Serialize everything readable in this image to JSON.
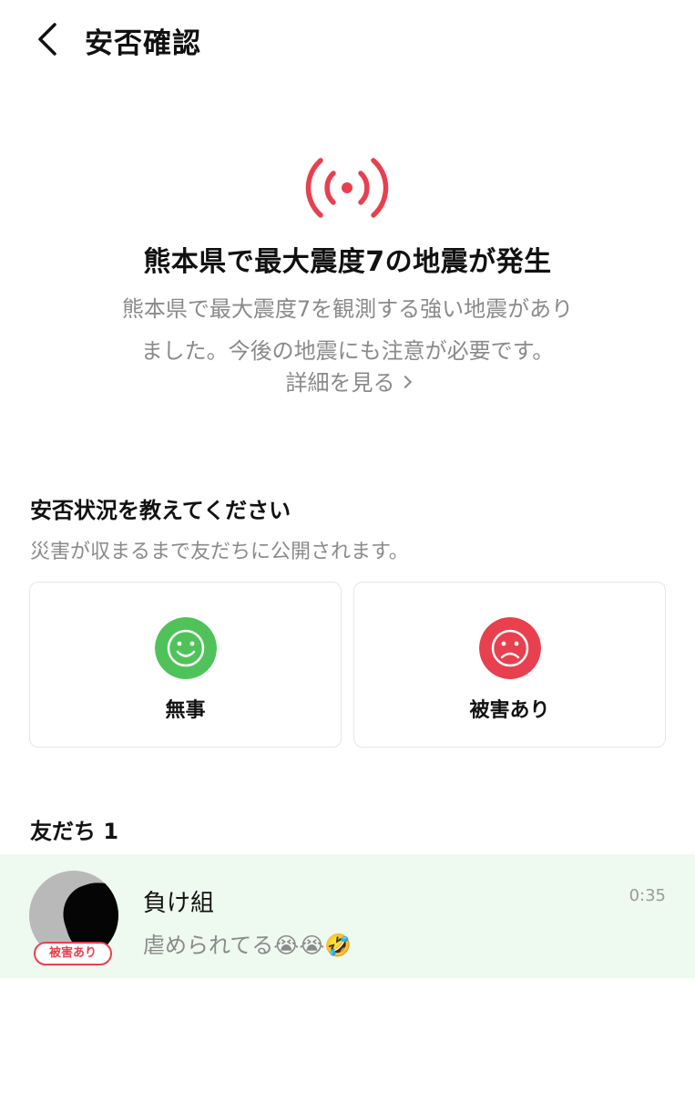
{
  "header": {
    "title": "安否確認",
    "back_icon": "chevron-left-icon"
  },
  "alert": {
    "icon": "broadcast-signal-icon",
    "icon_color": "#e8404e",
    "title": "熊本県で最大震度7の地震が発生",
    "description_line1": "熊本県で最大震度7を観測する強い地震があり",
    "description_line2": "ました。今後の地震にも注意が必要です。",
    "detail_link": "詳細を見る"
  },
  "status_section": {
    "title": "安否状況を教えてください",
    "subtitle": "災害が収まるまで友だちに公開されます。",
    "options": [
      {
        "label": "無事",
        "icon": "smile-face-icon",
        "color": "#4fc35a"
      },
      {
        "label": "被害あり",
        "icon": "sad-face-icon",
        "color": "#e8404e"
      }
    ]
  },
  "friends": {
    "title": "友だち 1",
    "items": [
      {
        "name": "負け組",
        "message": "虐められてる😭😭🤣",
        "time": "0:35",
        "badge": "被害あり",
        "highlight_color": "#eef9f0"
      }
    ]
  }
}
